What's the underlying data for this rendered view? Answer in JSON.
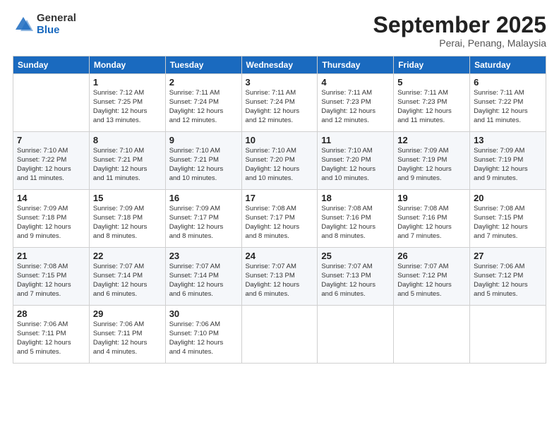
{
  "logo": {
    "general": "General",
    "blue": "Blue"
  },
  "title": "September 2025",
  "subtitle": "Perai, Penang, Malaysia",
  "days_header": [
    "Sunday",
    "Monday",
    "Tuesday",
    "Wednesday",
    "Thursday",
    "Friday",
    "Saturday"
  ],
  "weeks": [
    [
      {
        "num": "",
        "info": ""
      },
      {
        "num": "1",
        "info": "Sunrise: 7:12 AM\nSunset: 7:25 PM\nDaylight: 12 hours\nand 13 minutes."
      },
      {
        "num": "2",
        "info": "Sunrise: 7:11 AM\nSunset: 7:24 PM\nDaylight: 12 hours\nand 12 minutes."
      },
      {
        "num": "3",
        "info": "Sunrise: 7:11 AM\nSunset: 7:24 PM\nDaylight: 12 hours\nand 12 minutes."
      },
      {
        "num": "4",
        "info": "Sunrise: 7:11 AM\nSunset: 7:23 PM\nDaylight: 12 hours\nand 12 minutes."
      },
      {
        "num": "5",
        "info": "Sunrise: 7:11 AM\nSunset: 7:23 PM\nDaylight: 12 hours\nand 11 minutes."
      },
      {
        "num": "6",
        "info": "Sunrise: 7:11 AM\nSunset: 7:22 PM\nDaylight: 12 hours\nand 11 minutes."
      }
    ],
    [
      {
        "num": "7",
        "info": "Sunrise: 7:10 AM\nSunset: 7:22 PM\nDaylight: 12 hours\nand 11 minutes."
      },
      {
        "num": "8",
        "info": "Sunrise: 7:10 AM\nSunset: 7:21 PM\nDaylight: 12 hours\nand 11 minutes."
      },
      {
        "num": "9",
        "info": "Sunrise: 7:10 AM\nSunset: 7:21 PM\nDaylight: 12 hours\nand 10 minutes."
      },
      {
        "num": "10",
        "info": "Sunrise: 7:10 AM\nSunset: 7:20 PM\nDaylight: 12 hours\nand 10 minutes."
      },
      {
        "num": "11",
        "info": "Sunrise: 7:10 AM\nSunset: 7:20 PM\nDaylight: 12 hours\nand 10 minutes."
      },
      {
        "num": "12",
        "info": "Sunrise: 7:09 AM\nSunset: 7:19 PM\nDaylight: 12 hours\nand 9 minutes."
      },
      {
        "num": "13",
        "info": "Sunrise: 7:09 AM\nSunset: 7:19 PM\nDaylight: 12 hours\nand 9 minutes."
      }
    ],
    [
      {
        "num": "14",
        "info": "Sunrise: 7:09 AM\nSunset: 7:18 PM\nDaylight: 12 hours\nand 9 minutes."
      },
      {
        "num": "15",
        "info": "Sunrise: 7:09 AM\nSunset: 7:18 PM\nDaylight: 12 hours\nand 8 minutes."
      },
      {
        "num": "16",
        "info": "Sunrise: 7:09 AM\nSunset: 7:17 PM\nDaylight: 12 hours\nand 8 minutes."
      },
      {
        "num": "17",
        "info": "Sunrise: 7:08 AM\nSunset: 7:17 PM\nDaylight: 12 hours\nand 8 minutes."
      },
      {
        "num": "18",
        "info": "Sunrise: 7:08 AM\nSunset: 7:16 PM\nDaylight: 12 hours\nand 8 minutes."
      },
      {
        "num": "19",
        "info": "Sunrise: 7:08 AM\nSunset: 7:16 PM\nDaylight: 12 hours\nand 7 minutes."
      },
      {
        "num": "20",
        "info": "Sunrise: 7:08 AM\nSunset: 7:15 PM\nDaylight: 12 hours\nand 7 minutes."
      }
    ],
    [
      {
        "num": "21",
        "info": "Sunrise: 7:08 AM\nSunset: 7:15 PM\nDaylight: 12 hours\nand 7 minutes."
      },
      {
        "num": "22",
        "info": "Sunrise: 7:07 AM\nSunset: 7:14 PM\nDaylight: 12 hours\nand 6 minutes."
      },
      {
        "num": "23",
        "info": "Sunrise: 7:07 AM\nSunset: 7:14 PM\nDaylight: 12 hours\nand 6 minutes."
      },
      {
        "num": "24",
        "info": "Sunrise: 7:07 AM\nSunset: 7:13 PM\nDaylight: 12 hours\nand 6 minutes."
      },
      {
        "num": "25",
        "info": "Sunrise: 7:07 AM\nSunset: 7:13 PM\nDaylight: 12 hours\nand 6 minutes."
      },
      {
        "num": "26",
        "info": "Sunrise: 7:07 AM\nSunset: 7:12 PM\nDaylight: 12 hours\nand 5 minutes."
      },
      {
        "num": "27",
        "info": "Sunrise: 7:06 AM\nSunset: 7:12 PM\nDaylight: 12 hours\nand 5 minutes."
      }
    ],
    [
      {
        "num": "28",
        "info": "Sunrise: 7:06 AM\nSunset: 7:11 PM\nDaylight: 12 hours\nand 5 minutes."
      },
      {
        "num": "29",
        "info": "Sunrise: 7:06 AM\nSunset: 7:11 PM\nDaylight: 12 hours\nand 4 minutes."
      },
      {
        "num": "30",
        "info": "Sunrise: 7:06 AM\nSunset: 7:10 PM\nDaylight: 12 hours\nand 4 minutes."
      },
      {
        "num": "",
        "info": ""
      },
      {
        "num": "",
        "info": ""
      },
      {
        "num": "",
        "info": ""
      },
      {
        "num": "",
        "info": ""
      }
    ]
  ]
}
